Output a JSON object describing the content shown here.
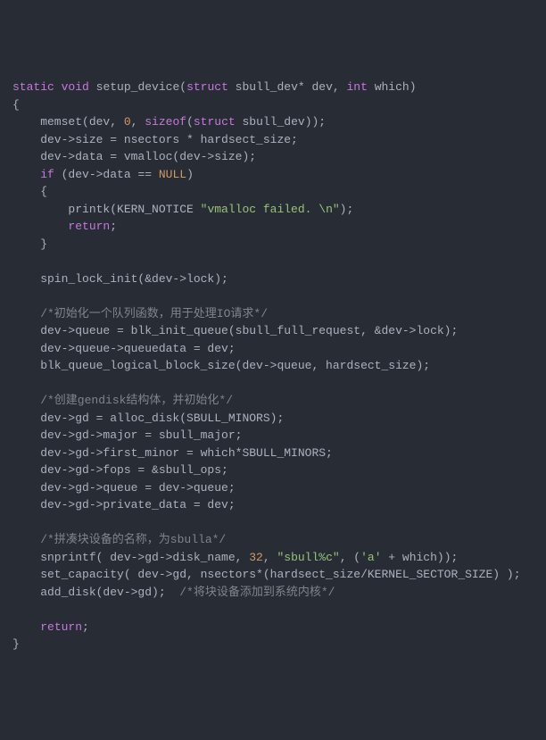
{
  "code": {
    "line1_static": "static",
    "line1_void": "void",
    "line1_func": " setup_device(",
    "line1_struct": "struct",
    "line1_rest": " sbull_dev* dev, ",
    "line1_int": "int",
    "line1_which": " which)",
    "line2": "{",
    "line3a": "    memset(dev, ",
    "line3_zero": "0",
    "line3b": ", ",
    "line3_sizeof": "sizeof",
    "line3c": "(",
    "line3_struct": "struct",
    "line3d": " sbull_dev));",
    "line4": "    dev->size = nsectors * hardsect_size;",
    "line5": "    dev->data = vmalloc(dev->size);",
    "line6a": "    ",
    "line6_if": "if",
    "line6b": " (dev->data == ",
    "line6_null": "NULL",
    "line6c": ")",
    "line7": "    {",
    "line8a": "        printk(KERN_NOTICE ",
    "line8_str": "\"vmalloc failed. \\n\"",
    "line8b": ");",
    "line9a": "        ",
    "line9_return": "return",
    "line9b": ";",
    "line10": "    }",
    "line11": "",
    "line12": "    spin_lock_init(&dev->lock);",
    "line13": "",
    "line14": "    /*初始化一个队列函数，用于处理IO请求*/",
    "line15": "    dev->queue = blk_init_queue(sbull_full_request, &dev->lock);",
    "line16": "    dev->queue->queuedata = dev;",
    "line17": "    blk_queue_logical_block_size(dev->queue, hardsect_size);",
    "line18": "",
    "line19": "    /*创建gendisk结构体，并初始化*/",
    "line20": "    dev->gd = alloc_disk(SBULL_MINORS);",
    "line21": "    dev->gd->major = sbull_major;",
    "line22": "    dev->gd->first_minor = which*SBULL_MINORS;",
    "line23": "    dev->gd->fops = &sbull_ops;",
    "line24": "    dev->gd->queue = dev->queue;",
    "line25": "    dev->gd->private_data = dev;",
    "line26": "",
    "line27": "    /*拼凑块设备的名称，为sbulla*/",
    "line28a": "    snprintf( dev->gd->disk_name, ",
    "line28_32": "32",
    "line28b": ", ",
    "line28_str": "\"sbull%c\"",
    "line28c": ", (",
    "line28_char": "'a'",
    "line28d": " + which));",
    "line29": "    set_capacity( dev->gd, nsectors*(hardsect_size/KERNEL_SECTOR_SIZE) );",
    "line30a": "    add_disk(dev->gd);  ",
    "line30_comment": "/*将块设备添加到系统内核*/",
    "line31": "",
    "line32a": "    ",
    "line32_return": "return",
    "line32b": ";",
    "line33": "}"
  }
}
